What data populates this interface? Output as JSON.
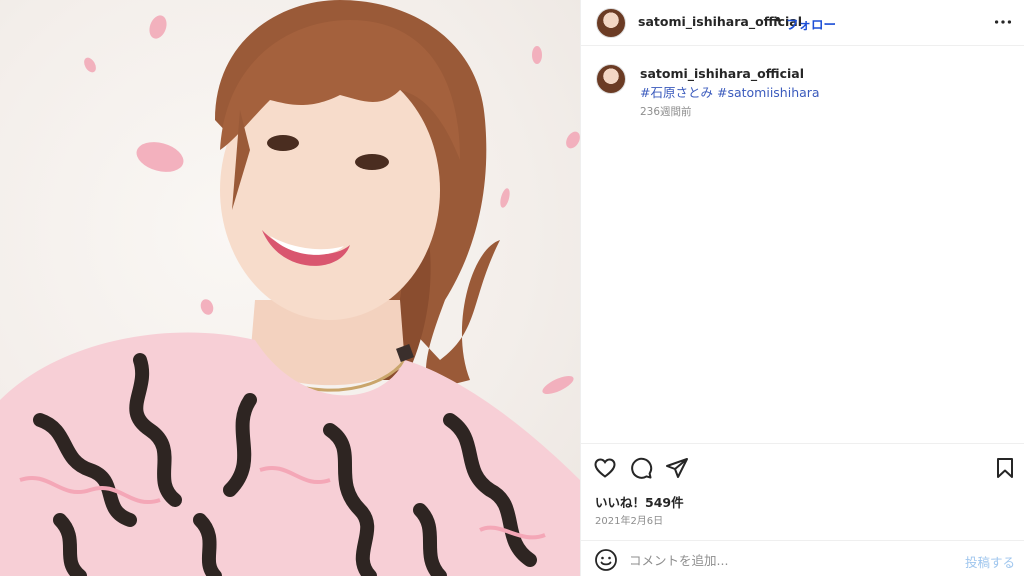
{
  "photo": {
    "icon": "portrait-photo"
  },
  "header": {
    "username": "satomi_ishihara_official",
    "separator": "•",
    "follow_label": "フォロー",
    "more_icon": "more-horizontal-icon"
  },
  "caption": {
    "username": "satomi_ishihara_official",
    "text": ".",
    "hashtags": [
      "#石原さとみ",
      "#satomiishihara"
    ],
    "time": "236週間前"
  },
  "actions": {
    "like_icon": "heart-icon",
    "comment_icon": "comment-icon",
    "share_icon": "send-icon",
    "save_icon": "bookmark-icon",
    "likes_text": "いいね！549件",
    "date": "2021年2月6日"
  },
  "comment": {
    "emoji_icon": "emoji-icon",
    "placeholder": "コメントを追加...",
    "post_label": "投稿する"
  },
  "colors": {
    "link": "#1d4fd6",
    "hashtag": "#3b5bbd",
    "muted": "#8e8e8e",
    "post_disabled": "#9fc6ee"
  }
}
